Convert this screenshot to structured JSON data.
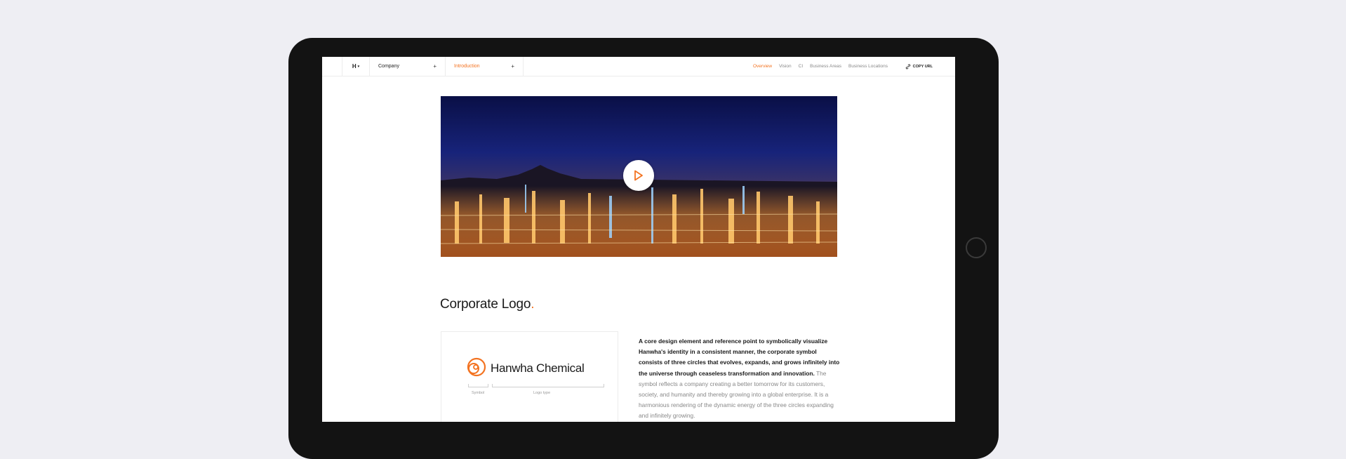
{
  "nav": {
    "logo": "H",
    "dropdown_company": "Company",
    "dropdown_intro": "Introduction",
    "subnav": [
      "Overview",
      "Vision",
      "CI",
      "Business Areas",
      "Business Locations"
    ],
    "copy_url": "COPY URL"
  },
  "hero": {
    "play_icon": "play-icon"
  },
  "section": {
    "title": "Corporate Logo",
    "title_dot": "."
  },
  "logo_card": {
    "brand_name": "Hanwha Chemical",
    "symbol_label": "Symbol",
    "logotype_label": "Logo type"
  },
  "description": {
    "strong": "A core design element and reference point to symbolically visualize Hanwha's identity in a consistent manner, the corporate symbol consists of three circles that evolves, expands, and grows infinitely into the universe through ceaseless transformation and innovation.",
    "light": "The symbol reflects a company creating a better tomorrow for its customers, society, and humanity and thereby growing into a global enterprise. It is a harmonious rendering of the dynamic energy of the three circles expanding and infinitely growing."
  },
  "colors": {
    "accent": "#f37321",
    "background": "#eeeef3",
    "device": "#131313"
  }
}
